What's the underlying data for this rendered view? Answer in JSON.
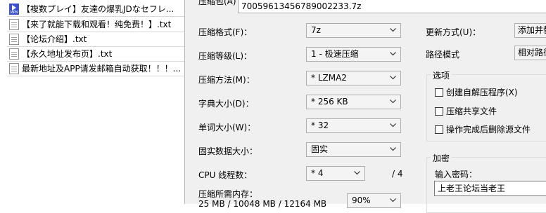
{
  "file_list": {
    "items": [
      {
        "icon": "video-file-icon",
        "name": "【複数プレイ】友達の爆乳JDなセフレ..."
      },
      {
        "icon": "text-file-icon",
        "name": "【来了就能下载和观看！纯免费！】.txt"
      },
      {
        "icon": "text-file-icon",
        "name": "【论坛介绍】.txt"
      },
      {
        "icon": "text-file-icon",
        "name": "【永久地址发布页】.txt"
      },
      {
        "icon": "text-file-icon",
        "name": "最新地址及APP请发邮箱自动获取！！！..."
      }
    ]
  },
  "dialog": {
    "archive_label": "压缩包(A)",
    "archive_name": "70059613456789002233.7z",
    "format_label": "压缩格式(F)：",
    "format_value": "7z",
    "level_label": "压缩等级(L)：",
    "level_value": "1 - 极速压缩",
    "method_label": "压缩方法(M)：",
    "method_value": "* LZMA2",
    "dict_label": "字典大小(D)：",
    "dict_value": "* 256 KB",
    "word_label": "单词大小(W)：",
    "word_value": "* 32",
    "solid_label": "固实数据大小：",
    "solid_value": "固实",
    "cpu_label": "CPU 线程数：",
    "cpu_value": "* 4",
    "cpu_total": "/ 4",
    "memory_label": "压缩所需内存：",
    "memory_value": "25 MB / 10048 MB / 12164 MB",
    "memory_percent": "90%",
    "update_label": "更新方式(U)：",
    "update_value": "添加并替",
    "path_label": "路径模式",
    "path_value": "相对路径",
    "options_title": "选项",
    "opt_sfx": "创建自解压程序(X)",
    "opt_shared": "压缩共享文件",
    "opt_delete": "操作完成后删除源文件",
    "encrypt_title": "加密",
    "password_label": "输入密码：",
    "password_value": "上老王论坛当老王"
  }
}
